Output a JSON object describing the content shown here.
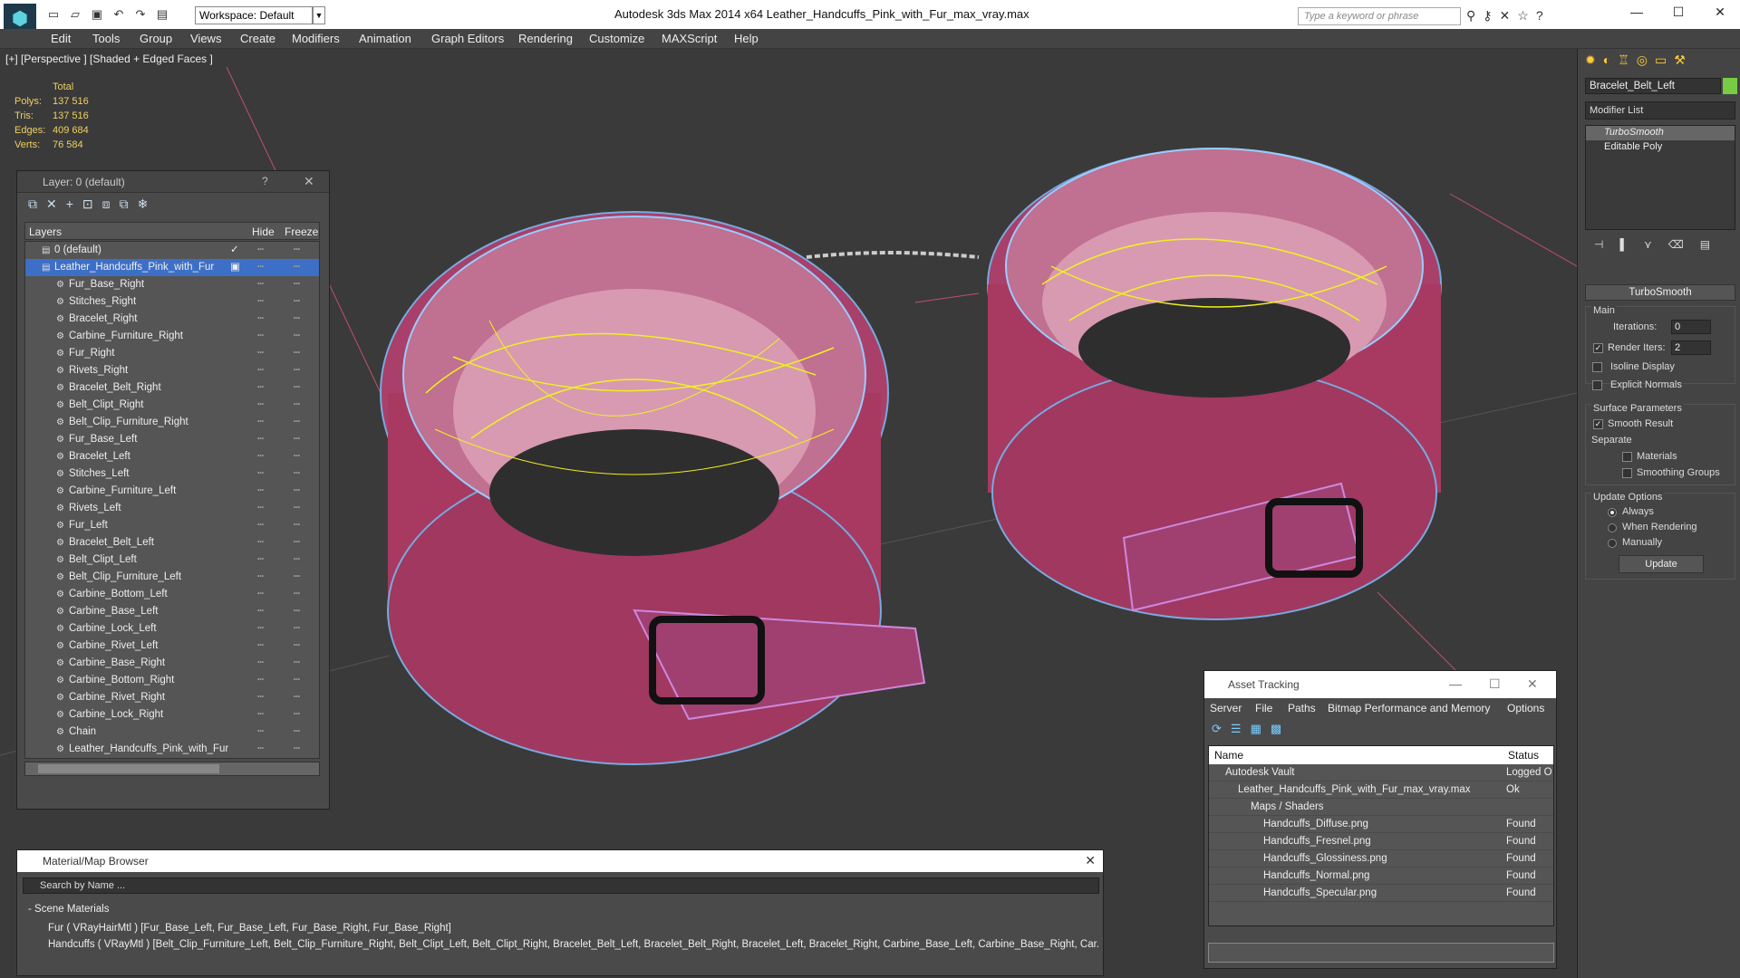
{
  "titlebar": {
    "workspace": "Workspace: Default",
    "title": "Autodesk 3ds Max  2014 x64      Leather_Handcuffs_Pink_with_Fur_max_vray.max",
    "search_placeholder": "Type a keyword or phrase"
  },
  "menu": [
    "Edit",
    "Tools",
    "Group",
    "Views",
    "Create",
    "Modifiers",
    "Animation",
    "Graph Editors",
    "Rendering",
    "Customize",
    "MAXScript",
    "Help"
  ],
  "viewport": {
    "label": "[+] [Perspective ] [Shaded + Edged Faces ]",
    "stats": {
      "total": "Total",
      "rows": [
        {
          "k": "Polys:",
          "v": "137 516"
        },
        {
          "k": "Tris:",
          "v": "137 516"
        },
        {
          "k": "Edges:",
          "v": "409 684"
        },
        {
          "k": "Verts:",
          "v": "76 584"
        }
      ]
    }
  },
  "layer_panel": {
    "title": "Layer: 0 (default)",
    "help": "?",
    "columns": {
      "layers": "Layers",
      "hide": "Hide",
      "freeze": "Freeze"
    },
    "top_layers": [
      {
        "name": "0 (default)"
      },
      {
        "name": "Leather_Handcuffs_Pink_with_Fur"
      }
    ],
    "objects": [
      "Fur_Base_Right",
      "Stitches_Right",
      "Bracelet_Right",
      "Carbine_Furniture_Right",
      "Fur_Right",
      "Rivets_Right",
      "Bracelet_Belt_Right",
      "Belt_Clipt_Right",
      "Belt_Clip_Furniture_Right",
      "Fur_Base_Left",
      "Bracelet_Left",
      "Stitches_Left",
      "Carbine_Furniture_Left",
      "Rivets_Left",
      "Fur_Left",
      "Bracelet_Belt_Left",
      "Belt_Clipt_Left",
      "Belt_Clip_Furniture_Left",
      "Carbine_Bottom_Left",
      "Carbine_Base_Left",
      "Carbine_Lock_Left",
      "Carbine_Rivet_Left",
      "Carbine_Base_Right",
      "Carbine_Bottom_Right",
      "Carbine_Rivet_Right",
      "Carbine_Lock_Right",
      "Chain",
      "Leather_Handcuffs_Pink_with_Fur"
    ]
  },
  "material_browser": {
    "title": "Material/Map Browser",
    "search_placeholder": "Search by Name ...",
    "section": "- Scene Materials",
    "rows": [
      "Fur ( VRayHairMtl ) [Fur_Base_Left, Fur_Base_Left, Fur_Base_Right, Fur_Base_Right]",
      "Handcuffs ( VRayMtl ) [Belt_Clip_Furniture_Left, Belt_Clip_Furniture_Right, Belt_Clipt_Left, Belt_Clipt_Right, Bracelet_Belt_Left, Bracelet_Belt_Right, Bracelet_Left, Bracelet_Right, Carbine_Base_Left, Carbine_Base_Right, Car..."
    ]
  },
  "asset_tracking": {
    "title": "Asset Tracking",
    "menu": [
      "Server",
      "File",
      "Paths",
      "Bitmap Performance and Memory",
      "Options"
    ],
    "columns": {
      "name": "Name",
      "status": "Status"
    },
    "rows": [
      {
        "name": "Autodesk Vault",
        "status": "Logged O",
        "indent": 0
      },
      {
        "name": "Leather_Handcuffs_Pink_with_Fur_max_vray.max",
        "status": "Ok",
        "indent": 1
      },
      {
        "name": "Maps / Shaders",
        "status": "",
        "indent": 2
      },
      {
        "name": "Handcuffs_Diffuse.png",
        "status": "Found",
        "indent": 3
      },
      {
        "name": "Handcuffs_Fresnel.png",
        "status": "Found",
        "indent": 3
      },
      {
        "name": "Handcuffs_Glossiness.png",
        "status": "Found",
        "indent": 3
      },
      {
        "name": "Handcuffs_Normal.png",
        "status": "Found",
        "indent": 3
      },
      {
        "name": "Handcuffs_Specular.png",
        "status": "Found",
        "indent": 3
      }
    ]
  },
  "command_panel": {
    "object_name": "Bracelet_Belt_Left",
    "modifier_list": "Modifier List",
    "stack": [
      "TurboSmooth",
      "Editable Poly"
    ],
    "rollout": "TurboSmooth",
    "main": "Main",
    "iterations_label": "Iterations:",
    "iterations": "0",
    "render_iters_label": "Render Iters:",
    "render_iters": "2",
    "isoline": "Isoline Display",
    "explicit_normals": "Explicit Normals",
    "surface_params": "Surface Parameters",
    "smooth_result": "Smooth Result",
    "separate": "Separate",
    "materials": "Materials",
    "smoothing_groups": "Smoothing Groups",
    "update_options": "Update Options",
    "always": "Always",
    "when_rendering": "When Rendering",
    "manually": "Manually",
    "update_btn": "Update"
  }
}
